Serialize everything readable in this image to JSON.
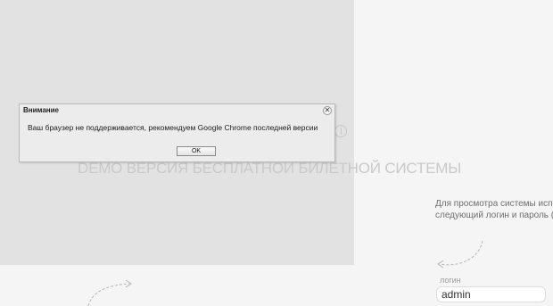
{
  "dialog": {
    "title": "Внимание",
    "message": "Ваш браузер не поддерживается, рекомендуем Google Chrome последней версии",
    "close_glyph": "✕",
    "ok_label": "OK"
  },
  "page": {
    "demo_title": "DEMO ВЕРСИЯ БЕСПЛАТНОЙ БИЛЕТНОЙ СИСТЕМЫ",
    "hint_line1": "Для просмотра системы исп",
    "hint_line2": "следующий логин и пароль (",
    "login_label": "логин",
    "login_value": "admin"
  },
  "colors": {
    "overlay": "#e2e2e2",
    "background": "#f4f4f4"
  }
}
